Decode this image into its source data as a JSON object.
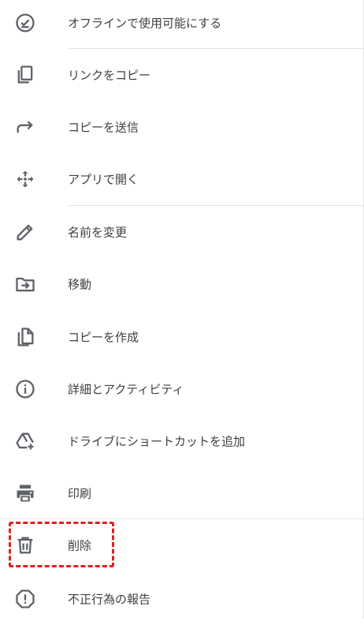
{
  "menu": {
    "items": [
      {
        "label": "オフラインで使用可能にする",
        "icon": "offline-check-icon"
      },
      {
        "label": "リンクをコピー",
        "icon": "copy-link-icon"
      },
      {
        "label": "コピーを送信",
        "icon": "send-copy-icon"
      },
      {
        "label": "アプリで開く",
        "icon": "open-with-icon"
      },
      {
        "label": "名前を変更",
        "icon": "pencil-icon"
      },
      {
        "label": "移動",
        "icon": "move-folder-icon"
      },
      {
        "label": "コピーを作成",
        "icon": "make-copy-icon"
      },
      {
        "label": "詳細とアクティビティ",
        "icon": "info-icon"
      },
      {
        "label": "ドライブにショートカットを追加",
        "icon": "add-drive-shortcut-icon"
      },
      {
        "label": "印刷",
        "icon": "print-icon"
      },
      {
        "label": "削除",
        "icon": "trash-icon"
      },
      {
        "label": "不正行為の報告",
        "icon": "report-icon"
      }
    ]
  },
  "colors": {
    "icon": "#5f6368",
    "text": "#3c4043",
    "divider": "#e3e3e3",
    "highlight": "#e02020"
  }
}
